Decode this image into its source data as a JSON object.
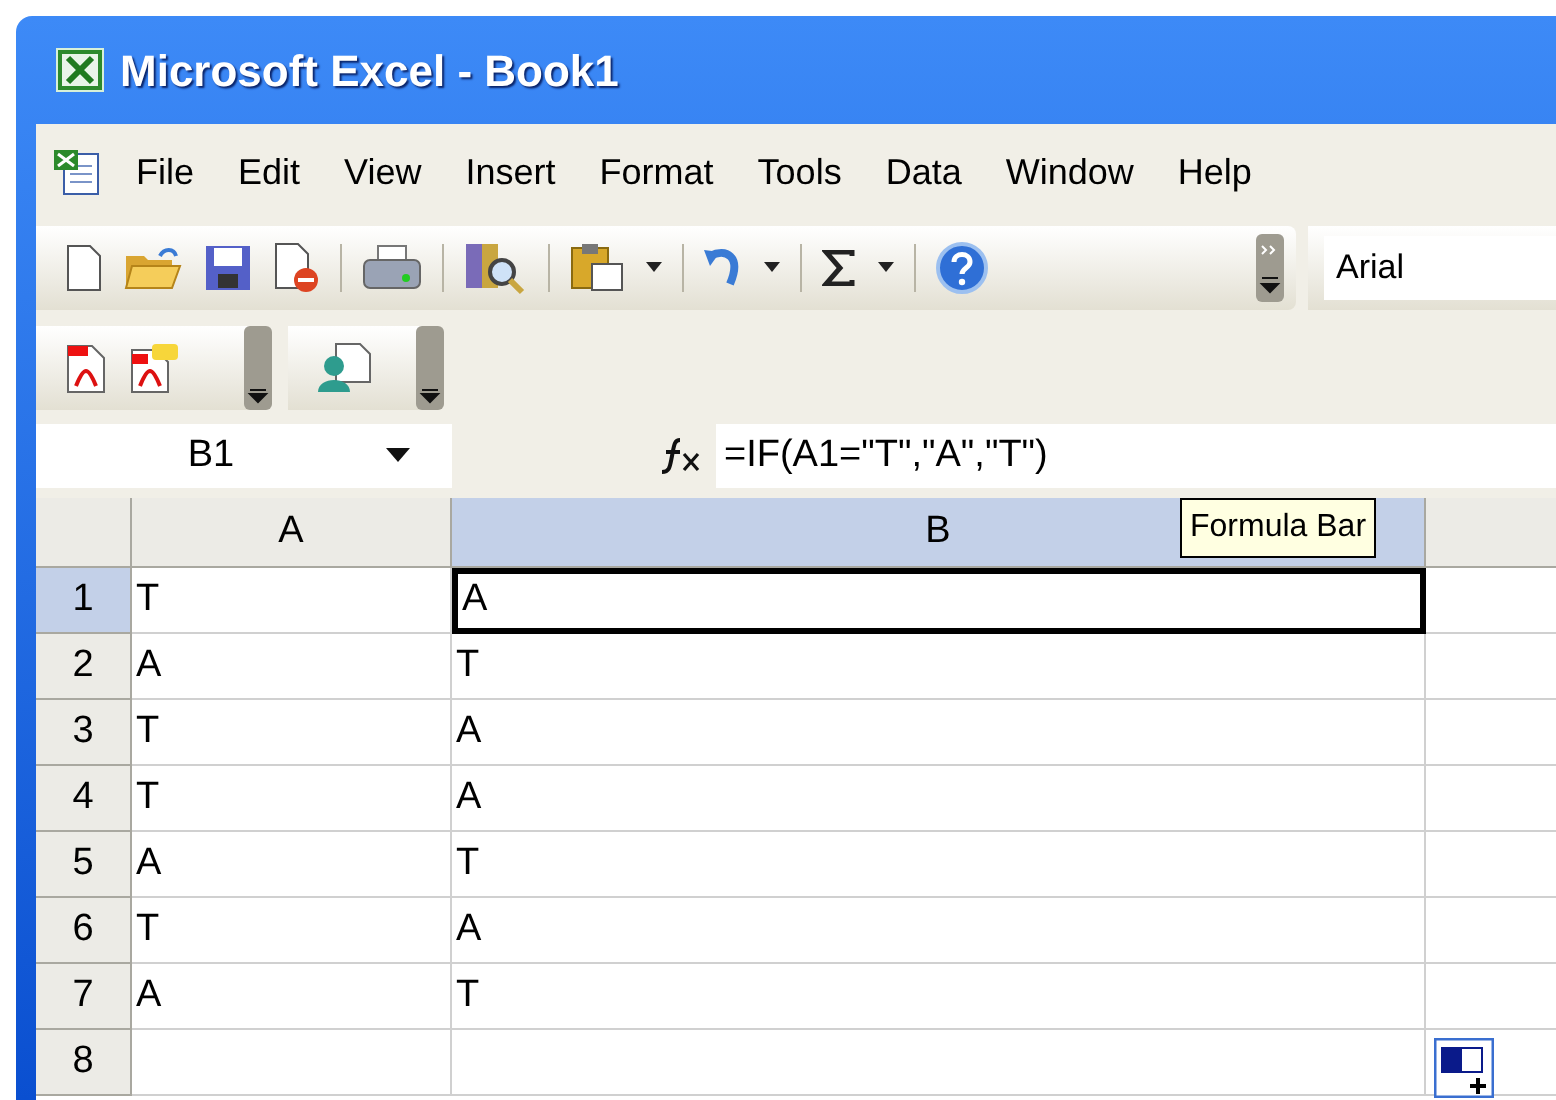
{
  "window": {
    "title": "Microsoft Excel - Book1"
  },
  "menu": [
    "File",
    "Edit",
    "View",
    "Insert",
    "Format",
    "Tools",
    "Data",
    "Window",
    "Help"
  ],
  "font_box": {
    "value": "Arial"
  },
  "name_box": {
    "value": "B1"
  },
  "formula": {
    "value": "=IF(A1=\"T\",\"A\",\"T\")"
  },
  "tooltip": "Formula Bar",
  "columns": [
    {
      "label": "A",
      "selected": false
    },
    {
      "label": "B",
      "selected": true
    },
    {
      "selected": false
    }
  ],
  "rows": [
    {
      "header": "1",
      "selected": true,
      "cells": [
        {
          "value": "T",
          "selected": false
        },
        {
          "value": "A",
          "selected": true
        }
      ]
    },
    {
      "header": "2",
      "selected": false,
      "cells": [
        {
          "value": "A",
          "selected": false
        },
        {
          "value": "T",
          "selected": false
        }
      ]
    },
    {
      "header": "3",
      "selected": false,
      "cells": [
        {
          "value": "T",
          "selected": false
        },
        {
          "value": "A",
          "selected": false
        }
      ]
    },
    {
      "header": "4",
      "selected": false,
      "cells": [
        {
          "value": "T",
          "selected": false
        },
        {
          "value": "A",
          "selected": false
        }
      ]
    },
    {
      "header": "5",
      "selected": false,
      "cells": [
        {
          "value": "A",
          "selected": false
        },
        {
          "value": "T",
          "selected": false
        }
      ]
    },
    {
      "header": "6",
      "selected": false,
      "cells": [
        {
          "value": "T",
          "selected": false
        },
        {
          "value": "A",
          "selected": false
        }
      ]
    },
    {
      "header": "7",
      "selected": false,
      "cells": [
        {
          "value": "A",
          "selected": false
        },
        {
          "value": "T",
          "selected": false
        }
      ]
    },
    {
      "header": "8",
      "selected": false,
      "cells": [
        {
          "selected": false
        },
        {
          "selected": false
        }
      ]
    }
  ]
}
